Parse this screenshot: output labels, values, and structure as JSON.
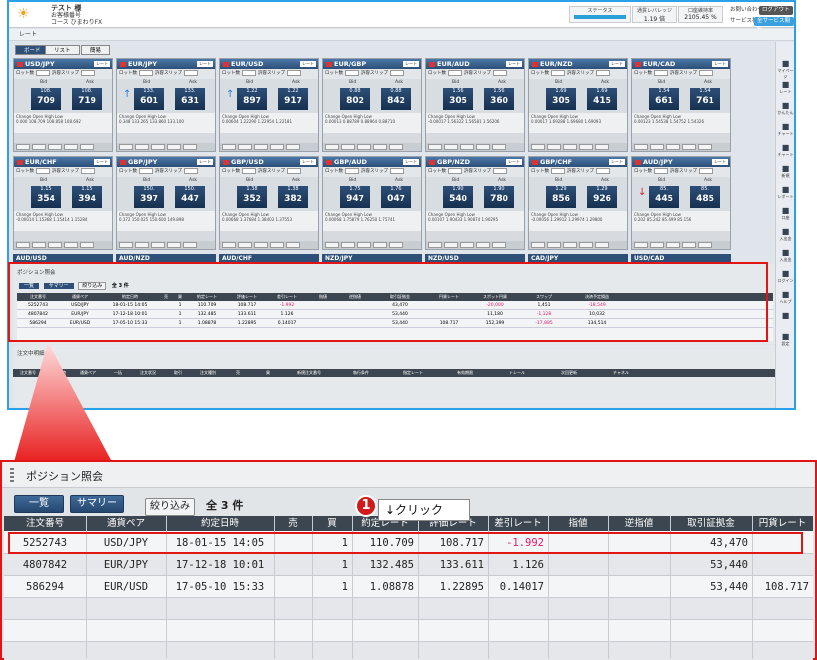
{
  "header": {
    "user_name": "テスト 様",
    "user_line2": "お客様番号",
    "user_line3": "コース ひまわりFX",
    "stats": [
      {
        "label": "ステータス",
        "value": ""
      },
      {
        "label": "通貨レバレッジ",
        "value": "1.19 倍"
      },
      {
        "label": "口座維持率",
        "value": "2105.45 %"
      }
    ],
    "contact": "お問い合わせ",
    "logout": "ログアウト",
    "service": "サービス状況",
    "all_service": "全サービス閲覧"
  },
  "rate_section": {
    "title": "レート",
    "tabs": [
      "ボード",
      "リスト",
      "簡易"
    ]
  },
  "rate_panels": [
    {
      "pair": "USD/JPY",
      "bid": "108.",
      "bid_big": "70",
      "bid_small": "9",
      "ask": "108.",
      "ask_big": "71",
      "ask_small": "9",
      "arrow": "",
      "change": "0.000",
      "open": "108.709",
      "high": "108.858",
      "low": "108.692"
    },
    {
      "pair": "EUR/JPY",
      "bid": "133.",
      "bid_big": "60",
      "bid_small": "1",
      "ask": "133.",
      "ask_big": "63",
      "ask_small": "1",
      "arrow": "up",
      "change": "0.348",
      "open": "133.265",
      "high": "133.860",
      "low": "133.100"
    },
    {
      "pair": "EUR/USD",
      "bid": "1.22",
      "bid_big": "89",
      "bid_small": "7",
      "ask": "1.22",
      "ask_big": "91",
      "ask_small": "7",
      "arrow": "up",
      "change": "0.00604",
      "open": "1.22290",
      "high": "1.22954",
      "low": "1.22181"
    },
    {
      "pair": "EUR/GBP",
      "bid": "0.88",
      "bid_big": "80",
      "bid_small": "2",
      "ask": "0.88",
      "ask_big": "84",
      "ask_small": "2",
      "arrow": "",
      "change": "0.00013",
      "open": "0.88789",
      "high": "0.88964",
      "low": "0.88710"
    },
    {
      "pair": "EUR/AUD",
      "bid": "1.56",
      "bid_big": "30",
      "bid_small": "5",
      "ask": "1.56",
      "ask_big": "36",
      "ask_small": "0",
      "arrow": "",
      "change": "-0.00017",
      "open": "1.56322",
      "high": "1.56581",
      "low": "1.56206"
    },
    {
      "pair": "EUR/NZD",
      "bid": "1.69",
      "bid_big": "30",
      "bid_small": "5",
      "ask": "1.69",
      "ask_big": "41",
      "ask_small": "5",
      "arrow": "",
      "change": "0.00017",
      "open": "1.69288",
      "high": "1.69680",
      "low": "1.69093"
    },
    {
      "pair": "EUR/CAD",
      "bid": "1.54",
      "bid_big": "66",
      "bid_small": "1",
      "ask": "1.54",
      "ask_big": "76",
      "ask_small": "1",
      "arrow": "",
      "change": "0.00123",
      "open": "1.54538",
      "high": "1.54752",
      "low": "1.54326"
    },
    {
      "pair": "EUR/CHF",
      "bid": "1.15",
      "bid_big": "35",
      "bid_small": "4",
      "ask": "1.15",
      "ask_big": "39",
      "ask_small": "4",
      "arrow": "",
      "change": "-0.00014",
      "open": "1.15368",
      "high": "1.15414",
      "low": "1.15284"
    },
    {
      "pair": "GBP/JPY",
      "bid": "150.",
      "bid_big": "39",
      "bid_small": "7",
      "ask": "150.",
      "ask_big": "44",
      "ask_small": "7",
      "arrow": "",
      "change": "0.372",
      "open": "150.025",
      "high": "150.600",
      "low": "149.898"
    },
    {
      "pair": "GBP/USD",
      "bid": "1.38",
      "bid_big": "35",
      "bid_small": "2",
      "ask": "1.38",
      "ask_big": "38",
      "ask_small": "2",
      "arrow": "",
      "change": "0.00668",
      "open": "1.37684",
      "high": "1.38403",
      "low": "1.37553"
    },
    {
      "pair": "GBP/AUD",
      "bid": "1.75",
      "bid_big": "94",
      "bid_small": "7",
      "ask": "1.76",
      "ask_big": "04",
      "ask_small": "7",
      "arrow": "",
      "change": "0.00068",
      "open": "1.75879",
      "high": "1.76250",
      "low": "1.75741"
    },
    {
      "pair": "GBP/NZD",
      "bid": "1.90",
      "bid_big": "54",
      "bid_small": "0",
      "ask": "1.90",
      "ask_big": "78",
      "ask_small": "0",
      "arrow": "",
      "change": "0.00107",
      "open": "1.90433",
      "high": "1.90874",
      "low": "1.90295"
    },
    {
      "pair": "GBP/CHF",
      "bid": "1.29",
      "bid_big": "85",
      "bid_small": "6",
      "ask": "1.29",
      "ask_big": "92",
      "ask_small": "6",
      "arrow": "",
      "change": "-0.00056",
      "open": "1.29912",
      "high": "1.29974",
      "low": "1.29800"
    },
    {
      "pair": "AUD/JPY",
      "bid": "85.",
      "bid_big": "44",
      "bid_small": "5",
      "ask": "85.",
      "ask_big": "48",
      "ask_small": "5",
      "arrow": "down",
      "change": "0.202",
      "open": "85.242",
      "high": "85.499",
      "low": "85.156"
    }
  ],
  "rate_row3": [
    "AUD/USD",
    "AUD/NZD",
    "AUD/CHF",
    "NZD/JPY",
    "NZD/USD",
    "CAD/JPY",
    "USD/CAD"
  ],
  "sidebar": [
    "マイページ",
    "レート",
    "かんたん",
    "チャート",
    "チャート",
    "新規",
    "レポート",
    "口座",
    "入出金",
    "入出金",
    "ログイン",
    "ヘルプ",
    "",
    "設定"
  ],
  "position": {
    "title": "ポジション照会",
    "btn_list": "一覧",
    "btn_summary": "サマリー",
    "btn_filter": "絞り込み",
    "count_label": "全 3 件",
    "columns": [
      "注文番号",
      "通貨ペア",
      "約定日時",
      "売",
      "買",
      "約定レート",
      "評価レート",
      "差引レート",
      "指値",
      "逆指値",
      "取引証拠金",
      "円貨レート"
    ],
    "mini_columns": [
      "注文番号",
      "通貨ペア",
      "約定日時",
      "売",
      "買",
      "約定レート",
      "評価レート",
      "差引レート",
      "指値",
      "逆指値",
      "取引証拠金",
      "円貨レート",
      "スポット円貨",
      "スワップ",
      "決済予定損益"
    ],
    "rows": [
      {
        "order": "5252743",
        "pair": "USD/JPY",
        "date": "18-01-15 14:05",
        "sell": "",
        "buy": "1",
        "exec": "110.709",
        "eval": "108.717",
        "diff": "-1.992",
        "limit": "",
        "stop": "",
        "margin": "43,470",
        "yen": "",
        "spot": "-20,000",
        "swap": "1,451",
        "pl": "-18,549"
      },
      {
        "order": "4807842",
        "pair": "EUR/JPY",
        "date": "17-12-18 10:01",
        "sell": "",
        "buy": "1",
        "exec": "132.485",
        "eval": "133.611",
        "diff": "1.126",
        "limit": "",
        "stop": "",
        "margin": "53,440",
        "yen": "",
        "spot": "11,180",
        "swap": "-1,128",
        "pl": "10,032"
      },
      {
        "order": "586294",
        "pair": "EUR/USD",
        "date": "17-05-10 15:33",
        "sell": "",
        "buy": "1",
        "exec": "1.08878",
        "eval": "1.22895",
        "diff": "0.14017",
        "limit": "",
        "stop": "",
        "margin": "53,440",
        "yen": "108.717",
        "spot": "152,399",
        "swap": "-17,885",
        "pl": "134,514"
      }
    ]
  },
  "orders": {
    "title": "注文中明細",
    "columns": [
      "注文番号",
      "注文日時",
      "通貨ペア",
      "一括",
      "注文状況",
      "取引",
      "注文種別",
      "売",
      "買",
      "新規注文番号",
      "執行条件",
      "指定レート",
      "有効期限",
      "トレール",
      "次回更新",
      "チャネル"
    ]
  },
  "annotation": {
    "step": "1",
    "text": "↓クリック"
  }
}
